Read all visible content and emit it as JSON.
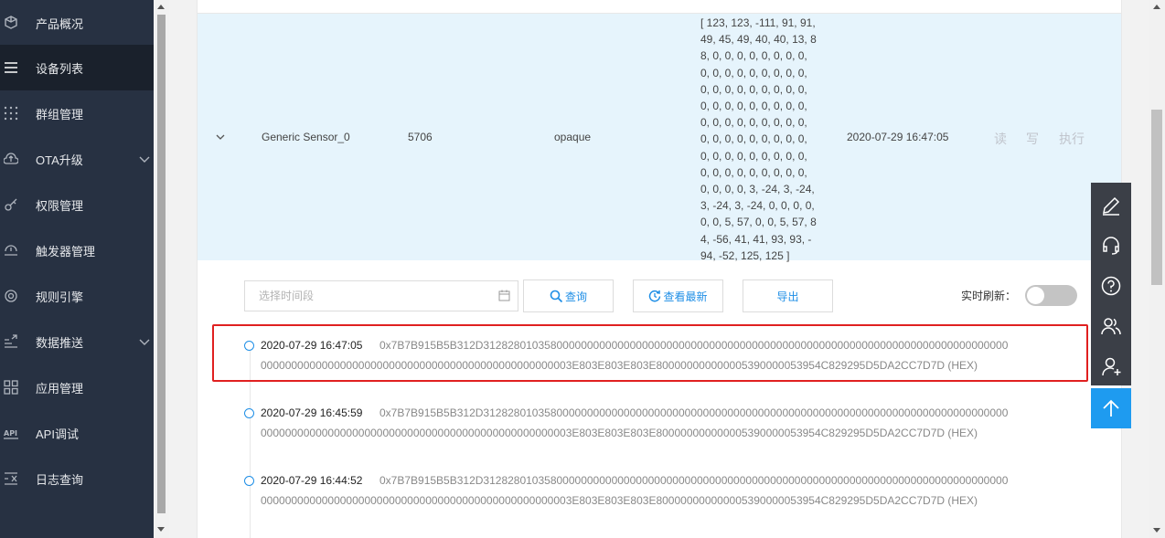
{
  "sidebar": {
    "items": [
      {
        "label": "产品概况",
        "icon": "cube-icon"
      },
      {
        "label": "设备列表",
        "icon": "list-icon",
        "active": true
      },
      {
        "label": "群组管理",
        "icon": "grid-dots-icon"
      },
      {
        "label": "OTA升级",
        "icon": "cloud-upload-icon",
        "expandable": true
      },
      {
        "label": "权限管理",
        "icon": "key-icon"
      },
      {
        "label": "触发器管理",
        "icon": "trigger-icon"
      },
      {
        "label": "规则引擎",
        "icon": "rule-icon"
      },
      {
        "label": "数据推送",
        "icon": "push-icon",
        "expandable": true
      },
      {
        "label": "应用管理",
        "icon": "apps-icon"
      },
      {
        "label": "API调试",
        "icon": "api-icon"
      },
      {
        "label": "日志查询",
        "icon": "log-icon"
      }
    ]
  },
  "resource_row": {
    "name": "Generic Sensor_0",
    "id": "5706",
    "type": "opaque",
    "value": "[ 123, 123, -111, 91, 91, 49, 45, 49, 40, 40, 13, 88, 0, 0, 0, 0, 0, 0, 0, 0, 0, 0, 0, 0, 0, 0, 0, 0, 0, 0, 0, 0, 0, 0, 0, 0, 0, 0, 0, 0, 0, 0, 0, 0, 0, 0, 0, 0, 0, 0, 0, 0, 0, 0, 0, 0, 0, 0, 0, 0, 0, 0, 0, 0, 0, 0, 0, 0, 0, 0, 0, 0, 0, 0, 0, 0, 0, 0, 0, 0, 0, 0, 0, 0, 0, 0, 0, 3, -24, 3, -24, 3, -24, 3, -24, 0, 0, 0, 0, 0, 0, 5, 57, 0, 0, 5, 57, 84, -56, 41, 41, 93, 93, -94, -52, 125, 125 ]",
    "time": "2020-07-29 16:47:05",
    "actions": {
      "read": "读",
      "write": "写",
      "execute": "执行"
    }
  },
  "toolbar": {
    "date_placeholder": "选择时间段",
    "query_label": "查询",
    "latest_label": "查看最新",
    "export_label": "导出",
    "realtime_label": "实时刷新：",
    "realtime_on": false
  },
  "logs": [
    {
      "time": "2020-07-29 16:47:05",
      "hex_line1": "0x7B7B915B5B312D31282801035800000000000000000000000000000000000000000000000000000000000000000000000000",
      "hex_line2": "000000000000000000000000000000000000000000000000003E803E803E803E800000000000005390000053954C829295D5DA2CC7D7D (HEX)",
      "highlighted": true
    },
    {
      "time": "2020-07-29 16:45:59",
      "hex_line1": "0x7B7B915B5B312D31282801035800000000000000000000000000000000000000000000000000000000000000000000000000",
      "hex_line2": "000000000000000000000000000000000000000000000000003E803E803E803E800000000000005390000053954C829295D5DA2CC7D7D (HEX)"
    },
    {
      "time": "2020-07-29 16:44:52",
      "hex_line1": "0x7B7B915B5B312D31282801035800000000000000000000000000000000000000000000000000000000000000000000000000",
      "hex_line2": "000000000000000000000000000000000000000000000000003E803E803E803E800000000000005390000053954C829295D5DA2CC7D7D (HEX)"
    }
  ],
  "float_toolbar": [
    "edit-icon",
    "headset-icon",
    "help-icon",
    "users-icon",
    "add-user-icon"
  ],
  "colors": {
    "sidebar_bg": "#273142",
    "accent": "#1e8ee6",
    "highlight_border": "#e02020",
    "row_highlight": "#e6f4fc"
  }
}
